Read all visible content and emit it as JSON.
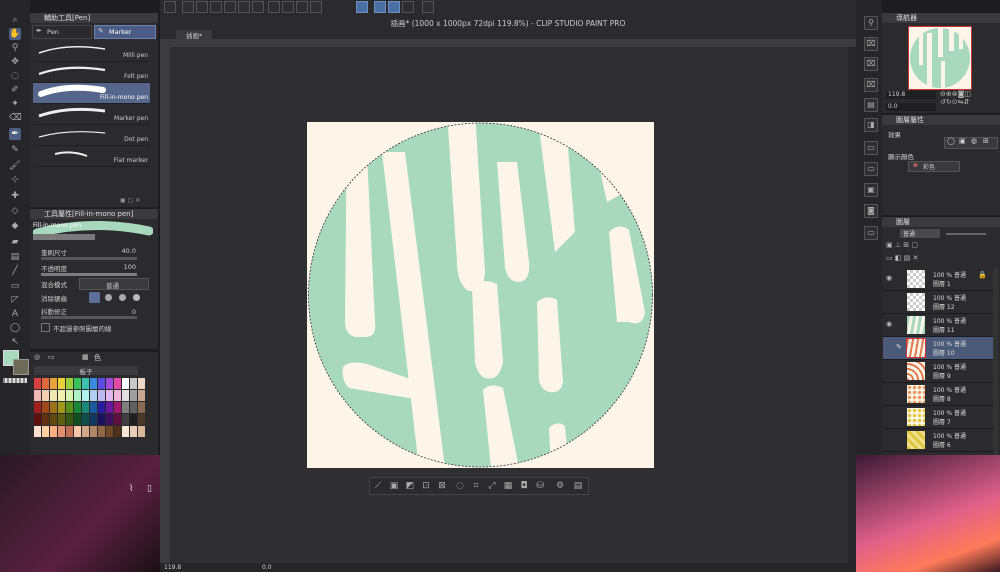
{
  "app": {
    "title": "插画* (1000 x 1000px 72dpi 119.8%) - CLIP STUDIO PAINT PRO",
    "canvas_tab": "插画*",
    "zoom": "119.8",
    "angle": "0.0"
  },
  "subtool": {
    "header": "輔助工具[Pen]",
    "tabs": [
      "Pen",
      "Marker"
    ],
    "brushes": [
      "Milli pen",
      "Felt pen",
      "Fill-in-mono pen",
      "Marker pen",
      "Dot pen",
      "Flat marker"
    ],
    "selected_brush_index": 2
  },
  "tool_property": {
    "header": "工具屬性[Fill-in-mono pen]",
    "preview_label": "Fill-in-mono pen",
    "brush_size_label": "筆刷尺寸",
    "brush_size_value": "40.0",
    "opacity_label": "不透明度",
    "opacity_value": "100",
    "blend_label": "混合模式",
    "blend_value": "普通",
    "anti_alias_label": "消除鋸齒",
    "stabilization_label": "抖動修正",
    "stabilization_value": "0",
    "no_overflow_label": "不超過參照圖層的線"
  },
  "color_set": {
    "title": "板子",
    "tab_label": "色"
  },
  "navigator": {
    "header": "導航器",
    "zoom": "119.8",
    "angle": "0.0"
  },
  "layer_property": {
    "header": "圖層屬性",
    "effect_label": "效果",
    "display_color_label": "顯示顏色",
    "display_color_value": "彩色"
  },
  "layers": {
    "header": "圖層",
    "blend_value": "普通",
    "items": [
      {
        "opacity": "100 %",
        "mode": "普通",
        "name": "圖層 1",
        "eye": true,
        "locked": true,
        "selected": false,
        "thumb": "checker"
      },
      {
        "opacity": "100 %",
        "mode": "普通",
        "name": "圖層 12",
        "eye": false,
        "locked": false,
        "selected": false,
        "thumb": "checker"
      },
      {
        "opacity": "100 %",
        "mode": "普通",
        "name": "圖層 11",
        "eye": true,
        "locked": false,
        "selected": false,
        "thumb": "green"
      },
      {
        "opacity": "100 %",
        "mode": "普通",
        "name": "圖層 10",
        "eye": false,
        "locked": false,
        "selected": true,
        "thumb": "orange-stripes"
      },
      {
        "opacity": "100 %",
        "mode": "普通",
        "name": "圖層 9",
        "eye": false,
        "locked": false,
        "selected": false,
        "thumb": "orange-curves"
      },
      {
        "opacity": "100 %",
        "mode": "普通",
        "name": "圖層 8",
        "eye": false,
        "locked": false,
        "selected": false,
        "thumb": "orange-dots"
      },
      {
        "opacity": "100 %",
        "mode": "普通",
        "name": "圖層 7",
        "eye": false,
        "locked": false,
        "selected": false,
        "thumb": "yellow-dots"
      },
      {
        "opacity": "100 %",
        "mode": "普通",
        "name": "圖層 6",
        "eye": false,
        "locked": false,
        "selected": false,
        "thumb": "yellow"
      }
    ]
  },
  "colors": {
    "accent": "#55658c",
    "artwork_green": "#a8d8bd",
    "artwork_cream": "#fdf6e8",
    "current_color": "#a8d8bd"
  }
}
